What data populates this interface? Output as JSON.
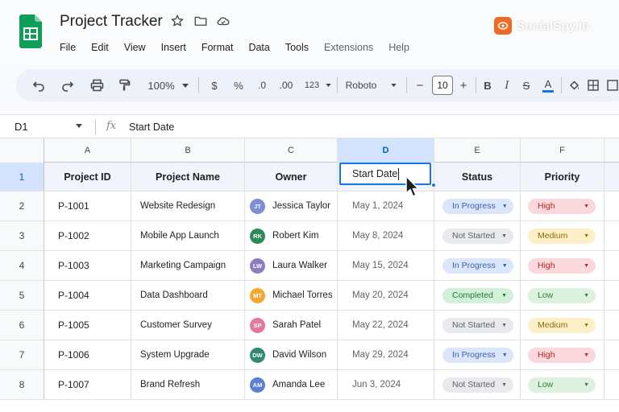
{
  "app": {
    "title": "Project Tracker",
    "menu": [
      "File",
      "Edit",
      "View",
      "Insert",
      "Format",
      "Data",
      "Tools",
      "Extensions",
      "Help"
    ],
    "watermark": "SocialSpy.io"
  },
  "toolbar": {
    "zoom": "100%",
    "currency": "$",
    "percent": "%",
    "decrease_decimal": ".0",
    "increase_decimal": ".00",
    "number_format": "123",
    "font": "Roboto",
    "font_size": "10",
    "minus": "−",
    "plus": "+",
    "bold": "B",
    "italic": "I",
    "strike": "S",
    "text_color_label": "A"
  },
  "formula_bar": {
    "cell_ref": "D1",
    "fx": "fx",
    "value": "Start Date"
  },
  "columns": [
    "A",
    "B",
    "C",
    "D",
    "E",
    "F"
  ],
  "selected_column": "D",
  "headers": [
    "Project ID",
    "Project Name",
    "Owner",
    "Start Date",
    "Status",
    "Priority"
  ],
  "editing_value": "Start Date",
  "rows": [
    {
      "num": "2",
      "id": "P-1001",
      "name": "Website Redesign",
      "initials": "JT",
      "owner": "Jessica Taylor",
      "avatar_color": "#7e8ed6",
      "date": "May 1, 2024",
      "status": "In Progress",
      "priority": "High"
    },
    {
      "num": "3",
      "id": "P-1002",
      "name": "Mobile App Launch",
      "initials": "RK",
      "owner": "Robert Kim",
      "avatar_color": "#2e8b57",
      "date": "May 8, 2024",
      "status": "Not Started",
      "priority": "Medium"
    },
    {
      "num": "4",
      "id": "P-1003",
      "name": "Marketing Campaign",
      "initials": "LW",
      "owner": "Laura Walker",
      "avatar_color": "#8e7cc3",
      "date": "May 15, 2024",
      "status": "In Progress",
      "priority": "High"
    },
    {
      "num": "5",
      "id": "P-1004",
      "name": "Data Dashboard",
      "initials": "MT",
      "owner": "Michael Torres",
      "avatar_color": "#f0a830",
      "date": "May 20, 2024",
      "status": "Completed",
      "priority": "Low"
    },
    {
      "num": "6",
      "id": "P-1005",
      "name": "Customer Survey",
      "initials": "SP",
      "owner": "Sarah Patel",
      "avatar_color": "#e07a9a",
      "date": "May 22, 2024",
      "status": "Not Started",
      "priority": "Medium"
    },
    {
      "num": "7",
      "id": "P-1006",
      "name": "System Upgrade",
      "initials": "DW",
      "owner": "David Wilson",
      "avatar_color": "#2e8b72",
      "date": "May 29, 2024",
      "status": "In Progress",
      "priority": "High"
    },
    {
      "num": "8",
      "id": "P-1007",
      "name": "Brand Refresh",
      "initials": "AM",
      "owner": "Amanda Lee",
      "avatar_color": "#5c7fd6",
      "date": "Jun 3, 2024",
      "status": "Not Started",
      "priority": "Low"
    }
  ],
  "chip_colors": {
    "In Progress": {
      "bg": "#dbe6fb",
      "fg": "#3b5fae"
    },
    "Not Started": {
      "bg": "#e8eaed",
      "fg": "#5f6368"
    },
    "Completed": {
      "bg": "#d3f0d9",
      "fg": "#1e7b3a"
    },
    "High": {
      "bg": "#fbd8dc",
      "fg": "#b3261e"
    },
    "Medium": {
      "bg": "#fdf0c9",
      "fg": "#8a6d00"
    },
    "Low": {
      "bg": "#dcf2de",
      "fg": "#2e7d32"
    }
  },
  "colors": {
    "accent": "#1a73e8",
    "sheets_green": "#0f9d58",
    "watermark_orange": "#f26a22"
  }
}
